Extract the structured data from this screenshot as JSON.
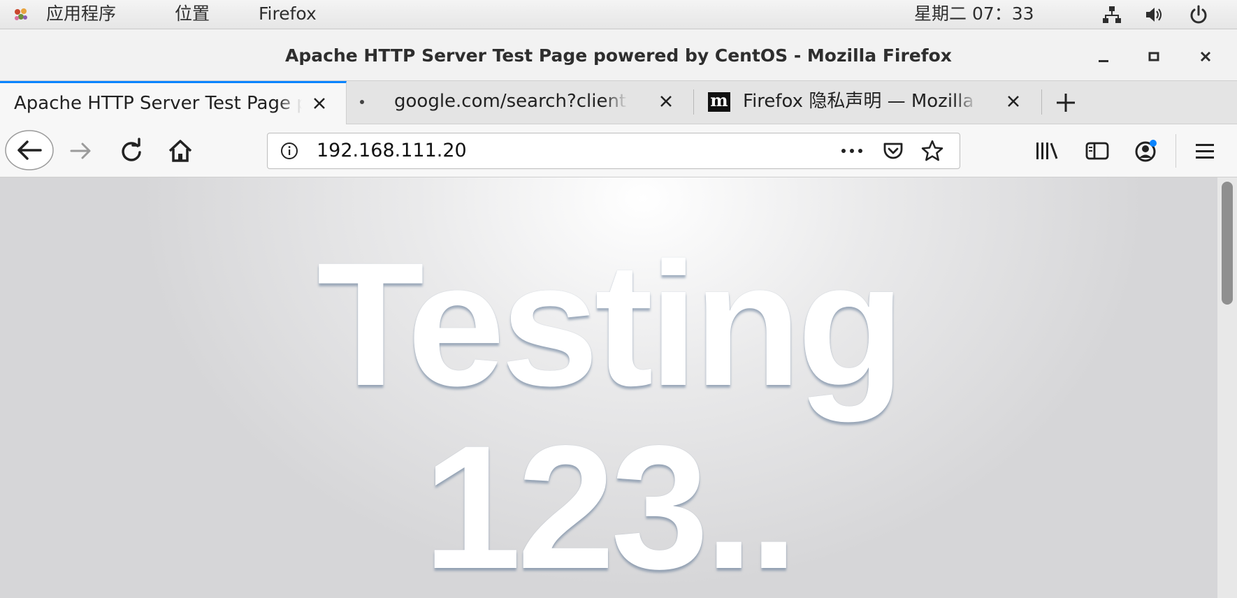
{
  "topbar": {
    "apps_label": "应用程序",
    "places_label": "位置",
    "app_name": "Firefox",
    "clock": "星期二 07：33"
  },
  "window": {
    "title": "Apache HTTP Server Test Page powered by CentOS - Mozilla Firefox"
  },
  "tabs": [
    {
      "label": "Apache HTTP Server Test Page powered by CentOS",
      "active": true
    },
    {
      "label": "google.com/search?client=firefox-b",
      "active": false,
      "icon": "dot-icon"
    },
    {
      "label": "Firefox 隐私声明 — Mozilla",
      "active": false,
      "icon": "mozilla-m-icon",
      "icon_text": "m"
    }
  ],
  "navbar": {
    "url": "192.168.111.20"
  },
  "page": {
    "headline_line1": "Testing",
    "headline_line2": "123.."
  },
  "colors": {
    "accent": "#0a84ff",
    "notification_dot": "#0a84ff"
  }
}
